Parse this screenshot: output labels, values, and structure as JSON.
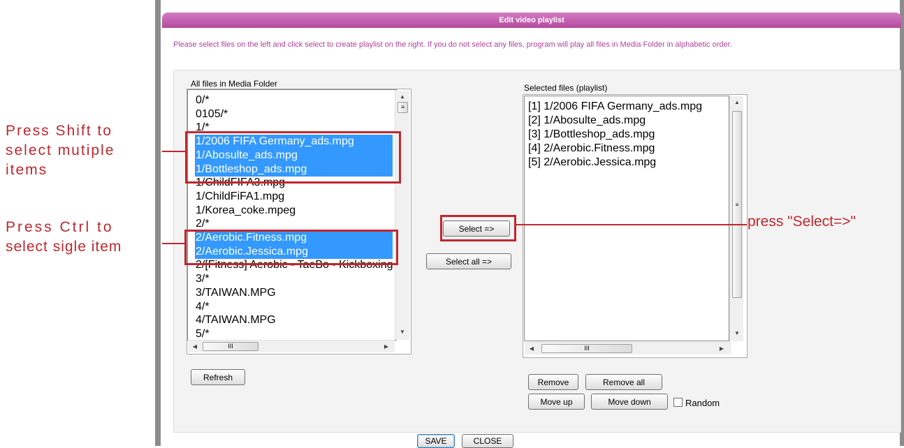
{
  "dialog": {
    "title": "Edit video playlist",
    "description": "Please select files on the left and click select to create playlist on the right. If you do not select any files, program will play all files in Media Folder in alphabetic order."
  },
  "left": {
    "label": "All files in Media Folder",
    "items": [
      {
        "text": "0/*",
        "selected": false
      },
      {
        "text": "0105/*",
        "selected": false
      },
      {
        "text": "1/*",
        "selected": false
      },
      {
        "text": "1/2006 FIFA Germany_ads.mpg",
        "selected": true
      },
      {
        "text": "1/Abosulte_ads.mpg",
        "selected": true
      },
      {
        "text": "1/Bottleshop_ads.mpg",
        "selected": true
      },
      {
        "text": "1/ChildFIFA3.mpg",
        "selected": false
      },
      {
        "text": "1/ChildFiFA1.mpg",
        "selected": false
      },
      {
        "text": "1/Korea_coke.mpeg",
        "selected": false
      },
      {
        "text": "2/*",
        "selected": false
      },
      {
        "text": "2/Aerobic.Fitness.mpg",
        "selected": true
      },
      {
        "text": "2/Aerobic.Jessica.mpg",
        "selected": true
      },
      {
        "text": "2/[Fitness] Aerobic - TaeBo - Kickboxing",
        "selected": false
      },
      {
        "text": "3/*",
        "selected": false
      },
      {
        "text": "3/TAIWAN.MPG",
        "selected": false
      },
      {
        "text": "4/*",
        "selected": false
      },
      {
        "text": "4/TAIWAN.MPG",
        "selected": false
      },
      {
        "text": "5/*",
        "selected": false
      }
    ],
    "refresh_label": "Refresh",
    "scroll_mark": "III"
  },
  "middle": {
    "select_label": "Select =>",
    "select_all_label": "Select all =>"
  },
  "right": {
    "label": "Selected files (playlist)",
    "items": [
      "[1] 1/2006 FIFA Germany_ads.mpg",
      "[2] 1/Abosulte_ads.mpg",
      "[3] 1/Bottleshop_ads.mpg",
      "[4] 2/Aerobic.Fitness.mpg",
      "[5] 2/Aerobic.Jessica.mpg"
    ],
    "remove_label": "Remove",
    "remove_all_label": "Remove all",
    "move_up_label": "Move up",
    "move_down_label": "Move down",
    "random_label": "Random",
    "random_checked": false,
    "scroll_mark": "III"
  },
  "footer": {
    "save_label": "SAVE",
    "close_label": "CLOSE"
  },
  "annotations": {
    "shift_line1": "Press Shift to",
    "shift_line2": "select mutiple",
    "shift_line3": "items",
    "ctrl_line1": "Press Ctrl to",
    "ctrl_line2": "select sigle item",
    "select_hint": "press \"Select=>\""
  },
  "colors": {
    "title_bar": "#b44a9f",
    "description_text": "#b13fa0",
    "selection": "#3399ff",
    "callout": "#c0272d"
  }
}
